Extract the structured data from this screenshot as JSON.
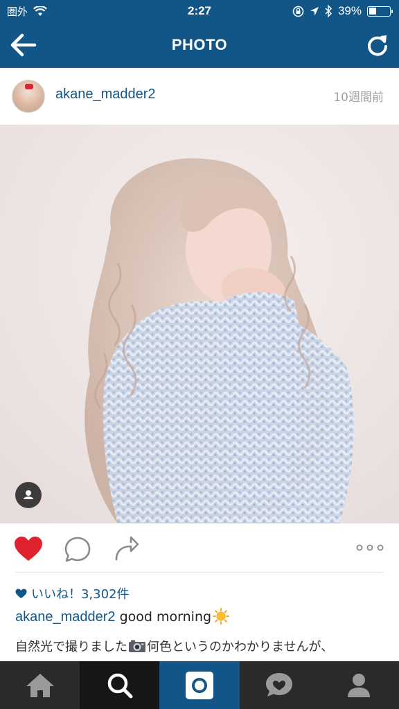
{
  "status_bar": {
    "carrier": "圏外",
    "time": "2:27",
    "battery_percent": "39%",
    "battery_level": 0.39,
    "icons": [
      "wifi-icon",
      "orientation-lock-icon",
      "location-icon",
      "bluetooth-icon",
      "battery-icon"
    ]
  },
  "nav": {
    "title": "PHOTO",
    "back_icon": "arrow-left-icon",
    "refresh_icon": "refresh-icon"
  },
  "post": {
    "username": "akane_madder2",
    "timestamp": "10週間前"
  },
  "actions": {
    "icons": [
      "heart-icon",
      "comment-icon",
      "share-icon",
      "more-icon"
    ],
    "liked": true,
    "like_color": "#e0222f"
  },
  "likes": {
    "text": "いいね！3,302件"
  },
  "caption": {
    "username": "akane_madder2",
    "text": "good morning"
  },
  "comment": {
    "text_before": "自然光で撮りました",
    "text_after": "何色というのかわかりませんが、"
  },
  "tab_bar": {
    "tabs": [
      "home-icon",
      "search-icon",
      "camera-icon",
      "activity-icon",
      "profile-icon"
    ],
    "active": "search-icon"
  },
  "colors": {
    "brand": "#125688",
    "tab_bar": "#2a2a2a",
    "muted": "#a0a0a0"
  }
}
